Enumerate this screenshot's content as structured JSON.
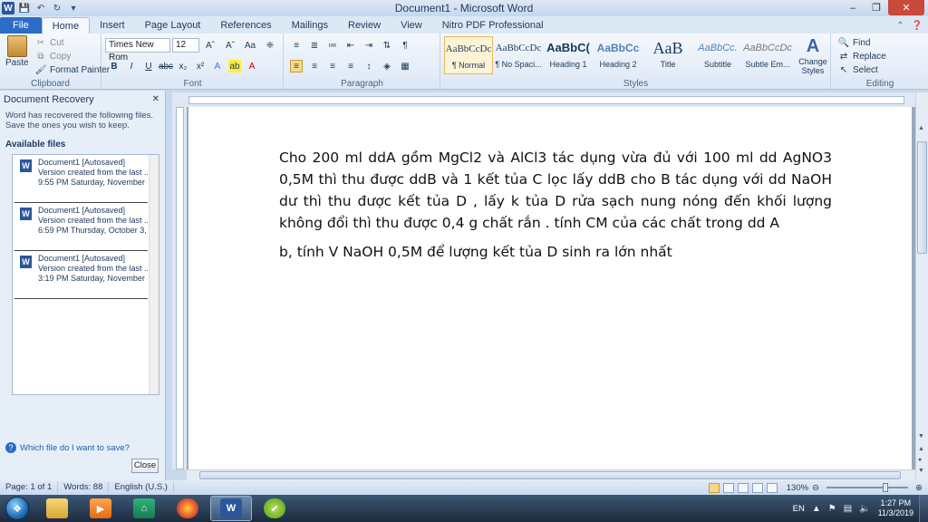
{
  "window": {
    "title": "Document1 - Microsoft Word",
    "app_logo": "W"
  },
  "tabs": [
    {
      "label": "File"
    },
    {
      "label": "Home"
    },
    {
      "label": "Insert"
    },
    {
      "label": "Page Layout"
    },
    {
      "label": "References"
    },
    {
      "label": "Mailings"
    },
    {
      "label": "Review"
    },
    {
      "label": "View"
    },
    {
      "label": "Nitro PDF Professional"
    }
  ],
  "ribbon": {
    "clipboard": {
      "label": "Clipboard",
      "paste": "Paste",
      "cut": "Cut",
      "copy": "Copy",
      "format_painter": "Format Painter"
    },
    "font": {
      "label": "Font",
      "font_name": "Times New Rom",
      "font_size": "12"
    },
    "paragraph": {
      "label": "Paragraph"
    },
    "styles": {
      "label": "Styles",
      "items": [
        {
          "sample": "AaBbCcDc",
          "name": "¶ Normal"
        },
        {
          "sample": "AaBbCcDc",
          "name": "¶ No Spaci..."
        },
        {
          "sample": "AaBbC(",
          "name": "Heading 1"
        },
        {
          "sample": "AaBbCc",
          "name": "Heading 2"
        },
        {
          "sample": "AaB",
          "name": "Title"
        },
        {
          "sample": "AaBbCc.",
          "name": "Subtitle"
        },
        {
          "sample": "AaBbCcDc",
          "name": "Subtle Em..."
        }
      ],
      "change_styles": "Change Styles"
    },
    "editing": {
      "label": "Editing",
      "find": "Find",
      "replace": "Replace",
      "select": "Select"
    }
  },
  "recovery": {
    "title": "Document Recovery",
    "message": "Word has recovered the following files.  Save the ones you wish to keep.",
    "available": "Available files",
    "files": [
      {
        "name": "Document1  [Autosaved]",
        "line1": "Version created from the last ...",
        "line2": "9:55 PM Saturday, November ..."
      },
      {
        "name": "Document1  [Autosaved]",
        "line1": "Version created from the last ...",
        "line2": "6:59 PM Thursday, October 3, ..."
      },
      {
        "name": "Document1  [Autosaved]",
        "line1": "Version created from the last ...",
        "line2": "3:19 PM Saturday, November ..."
      }
    ],
    "help": "Which file do I want to save?",
    "close": "Close"
  },
  "document": {
    "paragraph1": "Cho 200 ml ddA gồm MgCl2 và AlCl3 tác dụng vừa đủ với 100 ml dd AgNO3 0,5M thì thu được ddB và 1 kết tủa C lọc lấy ddB cho B tác dụng với dd NaOH dư thì thu được kết tủa D , lấy k tủa D rửa sạch nung nóng đến khối lượng không đổi thì thu được 0,4 g chất rắn . tính CM của các chất trong dd A",
    "paragraph2": "b, tính V NaOH 0,5M để lượng kết tủa D sinh ra lớn nhất"
  },
  "status": {
    "page": "Page: 1 of 1",
    "words": "Words: 88",
    "language": "English (U.S.)",
    "zoom": "130%"
  },
  "taskbar": {
    "word_label": "W",
    "lang": "EN",
    "time": "1:27 PM",
    "date": "11/3/2019"
  },
  "colors": {
    "accent": "#2b579a",
    "file_tab": "#2b6cc4"
  }
}
